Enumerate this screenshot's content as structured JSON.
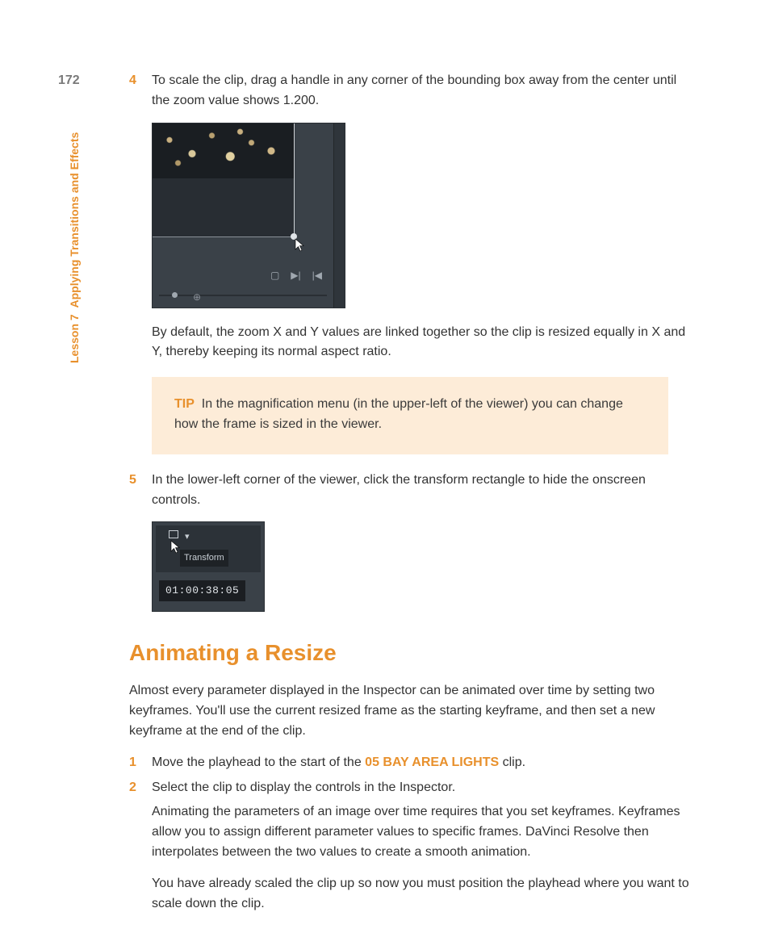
{
  "pageNumber": "172",
  "sidebar": {
    "lesson": "Lesson 7",
    "title": "Applying Transitions and Effects"
  },
  "step4": {
    "num": "4",
    "text": "To scale the clip, drag a handle in any corner of the bounding box away from the center until the zoom value shows 1.200."
  },
  "afterStep4": "By default, the zoom X and Y values are linked together so the clip is resized equally in X and Y, thereby keeping its normal aspect ratio.",
  "tip": {
    "label": "TIP",
    "text": "In the magnification menu (in the upper-left of the viewer) you can change how the frame is sized in the viewer."
  },
  "step5": {
    "num": "5",
    "text": "In the lower-left corner of the viewer, click the transform rectangle to hide the onscreen controls."
  },
  "sshot2": {
    "tooltip": "Transform",
    "timecode": "01:00:38:05"
  },
  "heading": "Animating a Resize",
  "intro": "Almost every parameter displayed in the Inspector can be animated over time by setting two keyframes. You'll use the current resized frame as the starting keyframe, and then set a new keyframe at the end of the clip.",
  "list1": {
    "num": "1",
    "pre": "Move the playhead to the start of the ",
    "bold": "05 BAY AREA LIGHTS",
    "post": " clip."
  },
  "list2": {
    "num": "2",
    "line1": "Select the clip to display the controls in the Inspector.",
    "para1": "Animating the parameters of an image over time requires that you set keyframes. Keyframes allow you to assign different parameter values to specific frames. DaVinci Resolve then interpolates between the two values to create a smooth animation.",
    "para2": "You have already scaled the clip up so now you must position the playhead where you want to scale down the clip."
  },
  "icons": {
    "frame": "▢",
    "next": "▶|",
    "prev": "|◀",
    "zoomPlus": "⊕",
    "chevDown": "▾"
  }
}
